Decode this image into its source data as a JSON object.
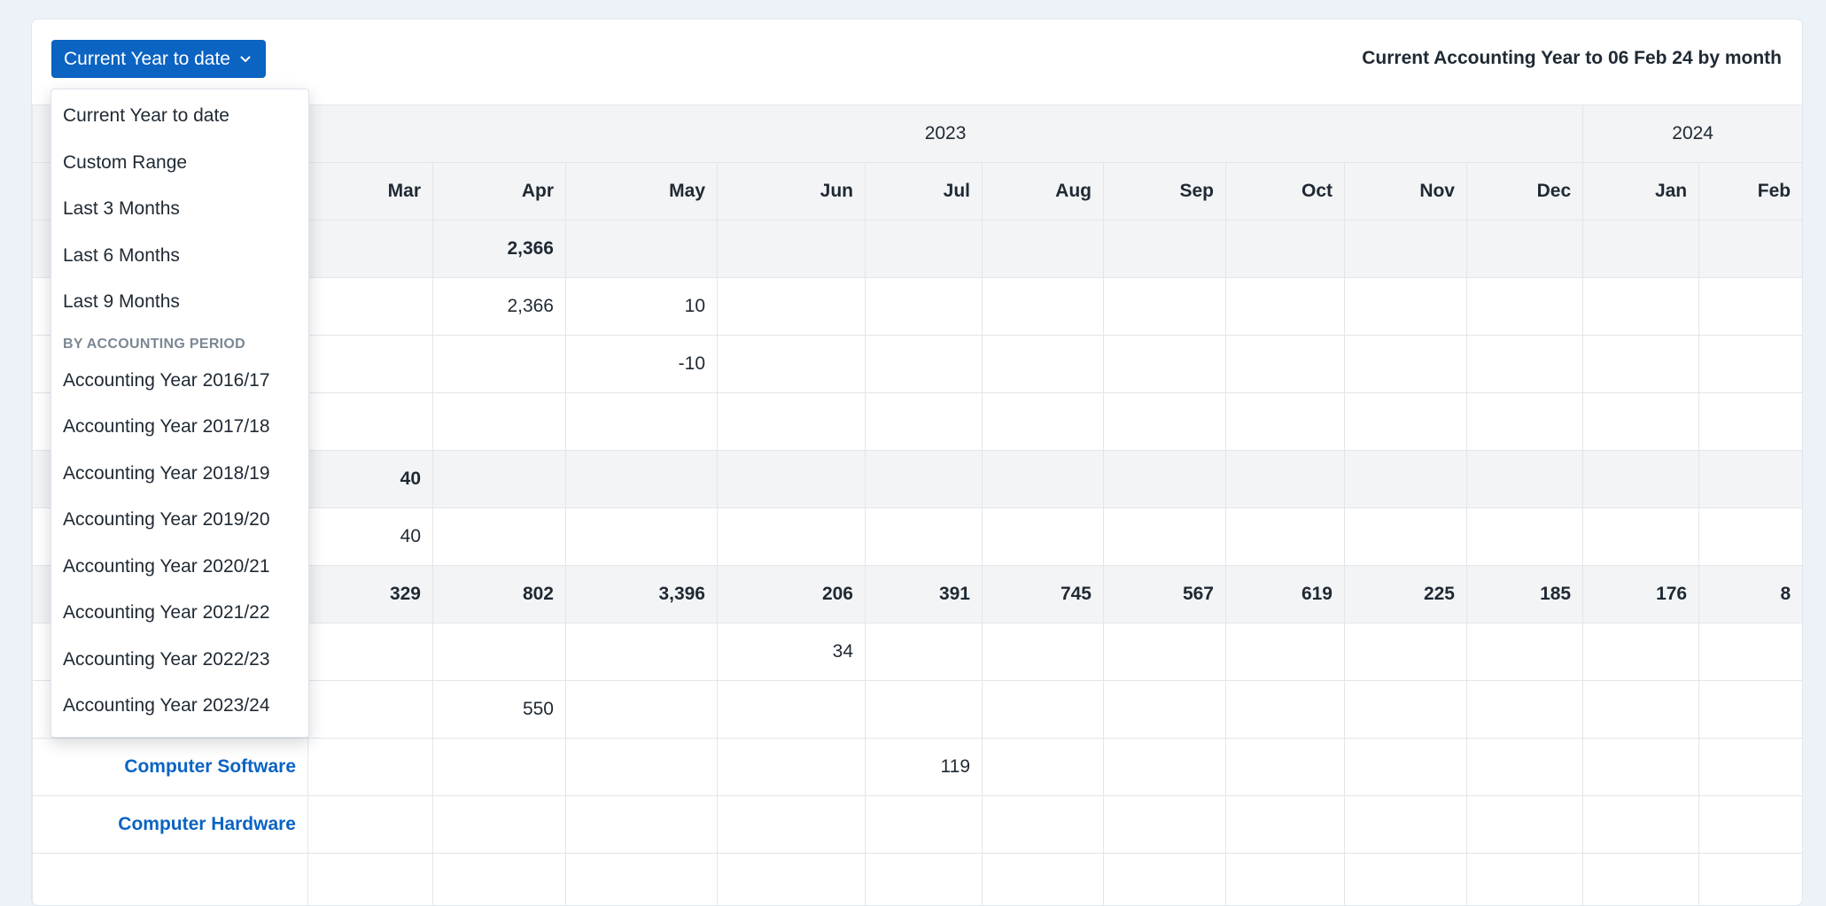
{
  "toolbar": {
    "period_button_label": "Current Year to date",
    "range_title": "Current Accounting Year to 06 Feb 24 by month"
  },
  "dropdown": {
    "items": [
      "Current Year to date",
      "Custom Range",
      "Last 3 Months",
      "Last 6 Months",
      "Last 9 Months"
    ],
    "section_label": "BY ACCOUNTING PERIOD",
    "period_items": [
      "Accounting Year 2016/17",
      "Accounting Year 2017/18",
      "Accounting Year 2018/19",
      "Accounting Year 2019/20",
      "Accounting Year 2020/21",
      "Accounting Year 2021/22",
      "Accounting Year 2022/23",
      "Accounting Year 2023/24"
    ]
  },
  "table": {
    "years": [
      "2023",
      "2024"
    ],
    "months": [
      "Mar",
      "Apr",
      "May",
      "Jun",
      "Jul",
      "Aug",
      "Sep",
      "Oct",
      "Nov",
      "Dec",
      "Jan",
      "Feb"
    ],
    "rows": [
      {
        "label": "",
        "values": [
          "",
          "2,366",
          "",
          "",
          "",
          "",
          "",
          "",
          "",
          "",
          "",
          ""
        ]
      },
      {
        "label": "",
        "values": [
          "",
          "2,366",
          "10",
          "",
          "",
          "",
          "",
          "",
          "",
          "",
          "",
          ""
        ]
      },
      {
        "label": "",
        "values": [
          "",
          "",
          "-10",
          "",
          "",
          "",
          "",
          "",
          "",
          "",
          "",
          ""
        ]
      },
      {
        "label": "",
        "values": [
          "",
          "",
          "",
          "",
          "",
          "",
          "",
          "",
          "",
          "",
          "",
          ""
        ]
      },
      {
        "label": "",
        "values": [
          "40",
          "",
          "",
          "",
          "",
          "",
          "",
          "",
          "",
          "",
          "",
          ""
        ]
      },
      {
        "label": "",
        "values": [
          "40",
          "",
          "",
          "",
          "",
          "",
          "",
          "",
          "",
          "",
          "",
          ""
        ]
      },
      {
        "label": "",
        "values": [
          "329",
          "802",
          "3,396",
          "206",
          "391",
          "745",
          "567",
          "619",
          "225",
          "185",
          "176",
          "8"
        ]
      },
      {
        "label": "",
        "values": [
          "",
          "",
          "",
          "34",
          "",
          "",
          "",
          "",
          "",
          "",
          "",
          ""
        ]
      },
      {
        "label": "",
        "values": [
          "",
          "550",
          "",
          "",
          "",
          "",
          "",
          "",
          "",
          "",
          "",
          ""
        ]
      },
      {
        "label": "Computer Software",
        "values": [
          "",
          "",
          "",
          "",
          "119",
          "",
          "",
          "",
          "",
          "",
          "",
          ""
        ]
      },
      {
        "label": "Computer Hardware",
        "values": [
          "",
          "",
          "",
          "",
          "",
          "",
          "",
          "",
          "",
          "",
          "",
          ""
        ]
      },
      {
        "label": "",
        "values": [
          "",
          "",
          "",
          "",
          "",
          "",
          "",
          "",
          "",
          "",
          "",
          ""
        ]
      }
    ]
  },
  "colors": {
    "accent": "#0b63c2",
    "page_background": "#edf2f9",
    "header_background": "#f3f4f6"
  }
}
